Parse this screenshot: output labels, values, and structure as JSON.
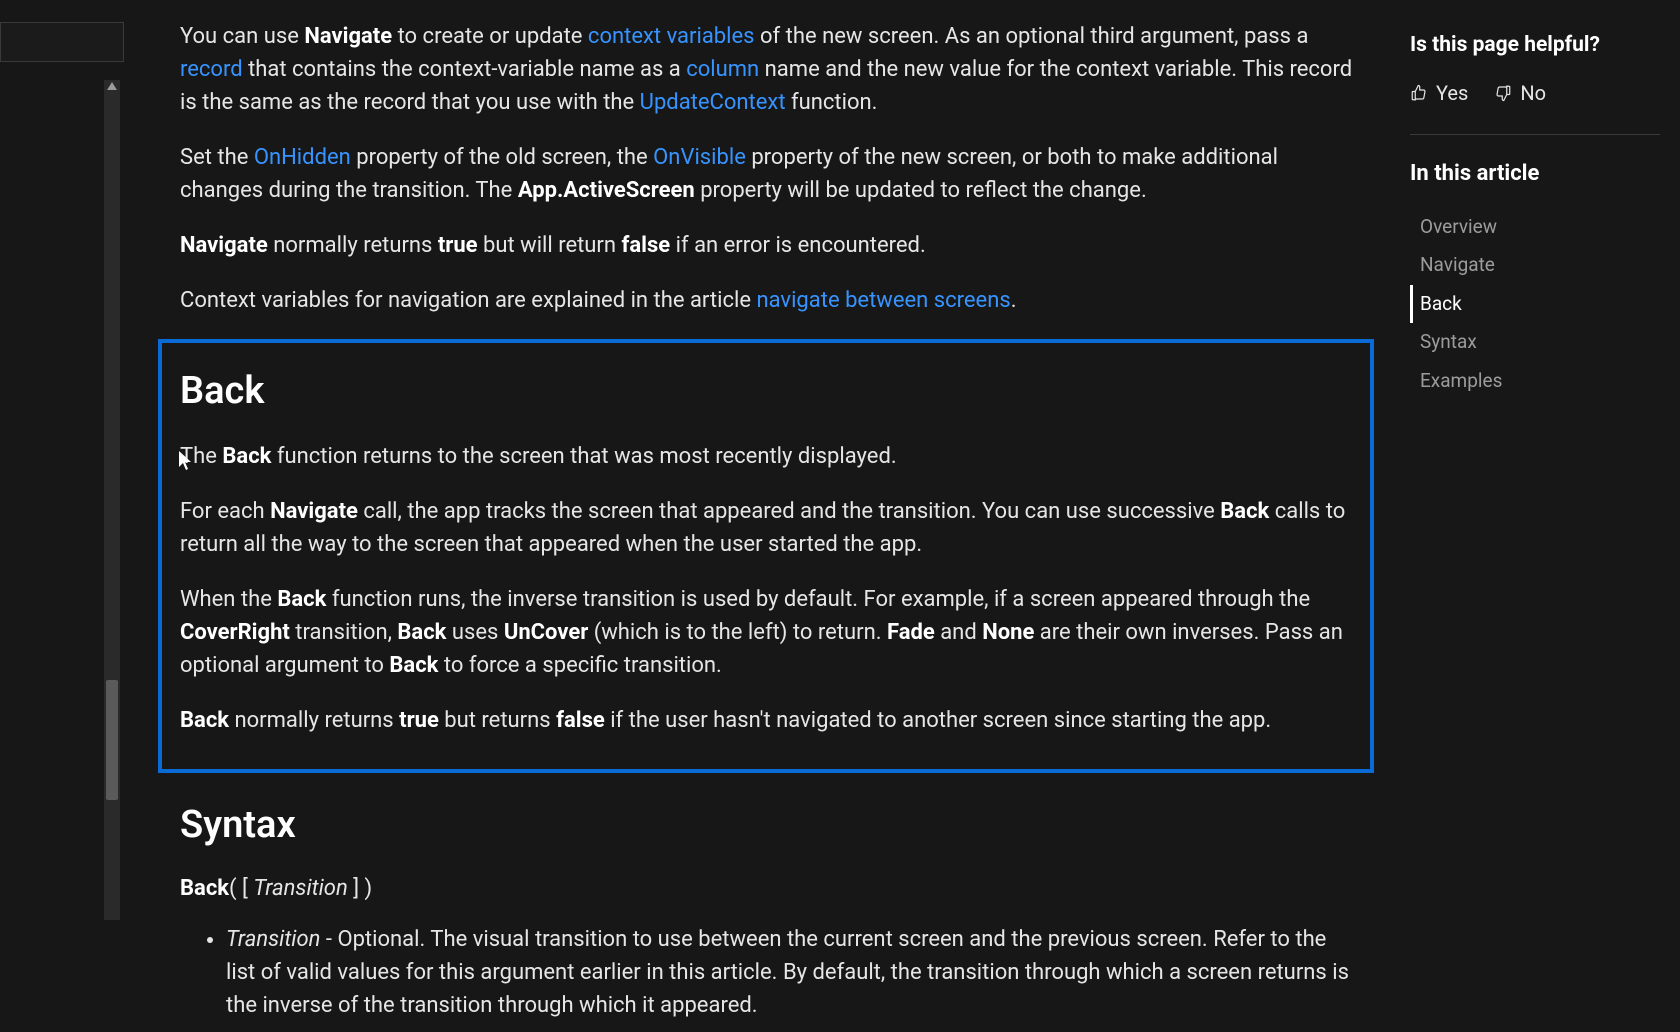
{
  "intro": {
    "p1": {
      "t1": "You can use ",
      "b1": "Navigate",
      "t2": " to create or update ",
      "l1": "context variables",
      "t3": " of the new screen. As an optional third argument, pass a ",
      "l2": "record",
      "t4": " that contains the context-variable name as a ",
      "l3": "column",
      "t5": " name and the new value for the context variable. This record is the same as the record that you use with the ",
      "l4": "UpdateContext",
      "t6": " function."
    },
    "p2": {
      "t1": "Set the ",
      "l1": "OnHidden",
      "t2": " property of the old screen, the ",
      "l2": "OnVisible",
      "t3": " property of the new screen, or both to make additional changes during the transition. The ",
      "b1": "App.ActiveScreen",
      "t4": " property will be updated to reflect the change."
    },
    "p3": {
      "b1": "Navigate",
      "t1": " normally returns ",
      "b2": "true",
      "t2": " but will return ",
      "b3": "false",
      "t3": " if an error is encountered."
    },
    "p4": {
      "t1": "Context variables for navigation are explained in the article ",
      "l1": "navigate between screens",
      "t2": "."
    }
  },
  "back": {
    "heading": "Back",
    "p1": {
      "t1": "The ",
      "b1": "Back",
      "t2": " function returns to the screen that was most recently displayed."
    },
    "p2": {
      "t1": "For each ",
      "b1": "Navigate",
      "t2": " call, the app tracks the screen that appeared and the transition. You can use successive ",
      "b2": "Back",
      "t3": " calls to return all the way to the screen that appeared when the user started the app."
    },
    "p3": {
      "t1": "When the ",
      "b1": "Back",
      "t2": " function runs, the inverse transition is used by default. For example, if a screen appeared through the ",
      "b2": "CoverRight",
      "t3": " transition, ",
      "b3": "Back",
      "t4": " uses ",
      "b4": "UnCover",
      "t5": " (which is to the left) to return. ",
      "b5": "Fade",
      "t6": " and ",
      "b6": "None",
      "t7": " are their own inverses. Pass an optional argument to ",
      "b7": "Back",
      "t8": " to force a specific transition."
    },
    "p4": {
      "b1": "Back",
      "t1": " normally returns ",
      "b2": "true",
      "t2": " but returns ",
      "b3": "false",
      "t3": " if the user hasn't navigated to another screen since starting the app."
    }
  },
  "syntax": {
    "heading": "Syntax",
    "line": {
      "fn": "Back",
      "open": "( [ ",
      "param": "Transition",
      "close": " ] )"
    },
    "params": [
      {
        "name": "Transition",
        "desc": " - Optional. The visual transition to use between the current screen and the previous screen. Refer to the list of valid values for this argument earlier in this article. By default, the transition through which a screen returns is the inverse of the transition through which it appeared."
      }
    ]
  },
  "sidebar": {
    "feedback_title": "Is this page helpful?",
    "yes": "Yes",
    "no": "No",
    "toc_title": "In this article",
    "toc": [
      "Overview",
      "Navigate",
      "Back",
      "Syntax",
      "Examples"
    ],
    "active": "Back"
  }
}
